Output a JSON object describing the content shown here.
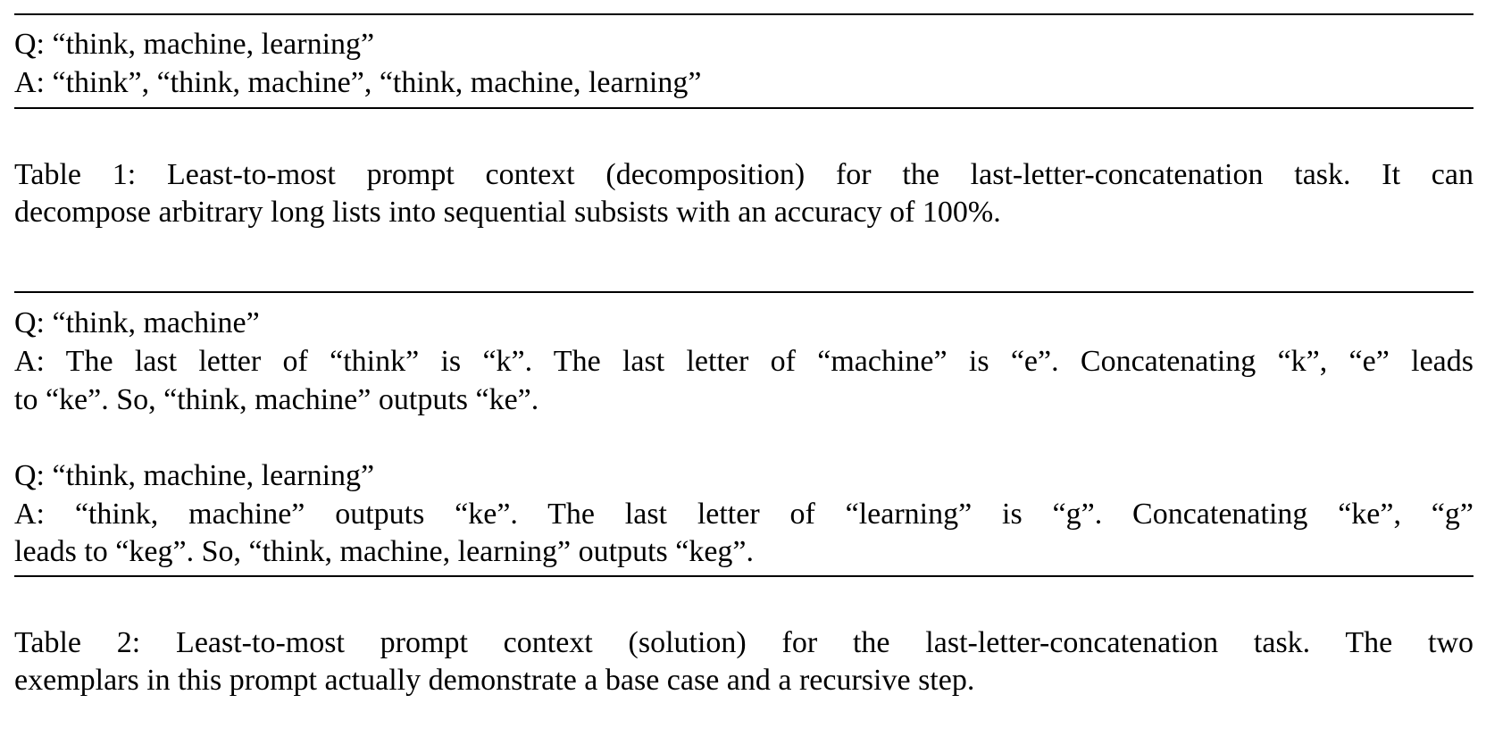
{
  "table1": {
    "lines": [
      "Q: “think, machine, learning”",
      "A: “think”, “think, machine”, “think, machine, learning”"
    ],
    "caption": [
      "Table 1: Least-to-most prompt context (decomposition) for the last-letter-concatenation task. It can",
      "decompose arbitrary long lists into sequential subsists with an accuracy of 100%."
    ]
  },
  "table2": {
    "exemplars": [
      {
        "q": "Q: “think, machine”",
        "a": [
          "A: The last letter of “think” is “k”. The last letter of “machine” is “e”. Concatenating “k”, “e” leads",
          "to “ke”. So, “think, machine” outputs “ke”."
        ]
      },
      {
        "q": "Q: “think, machine, learning”",
        "a": [
          "A: “think, machine” outputs “ke”.  The last letter of “learning” is “g”.  Concatenating “ke”, “g”",
          "leads to “keg”. So, “think, machine, learning” outputs “keg”."
        ]
      }
    ],
    "caption": [
      "Table 2:  Least-to-most prompt context (solution) for the last-letter-concatenation task.  The two",
      "exemplars in this prompt actually demonstrate a base case and a recursive step."
    ]
  }
}
